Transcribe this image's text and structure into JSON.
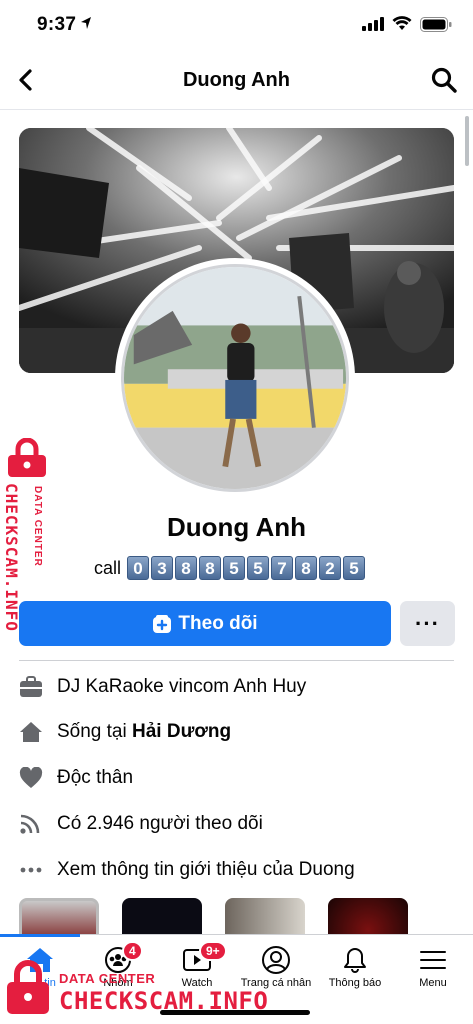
{
  "status_bar": {
    "time": "9:37"
  },
  "header": {
    "title": "Duong Anh"
  },
  "profile": {
    "name": "Duong Anh",
    "call_label": "call",
    "phone_digits": [
      "0",
      "3",
      "8",
      "8",
      "5",
      "5",
      "7",
      "8",
      "2",
      "5"
    ],
    "follow_label": "Theo dõi",
    "more_label": "···"
  },
  "info": {
    "work": "DJ KaRaoke vincom Anh Huy",
    "lives_prefix": "Sống tại ",
    "lives_place": "Hải Dương",
    "relationship": "Độc thân",
    "followers": "Có 2.946 người theo dõi",
    "see_more": "Xem thông tin giới thiệu của Duong"
  },
  "tabbar": {
    "tabs": [
      {
        "label": "tin",
        "icon": "home-icon"
      },
      {
        "label": "Nhóm",
        "icon": "groups-icon",
        "badge": "4"
      },
      {
        "label": "Watch",
        "icon": "watch-icon",
        "badge": "9+"
      },
      {
        "label": "Trang cá nhân",
        "icon": "profile-icon"
      },
      {
        "label": "Thông báo",
        "icon": "bell-icon"
      },
      {
        "label": "Menu",
        "icon": "menu-icon"
      }
    ]
  },
  "watermark": {
    "brand": "CHECKSCAM.INFO",
    "tagline": "DATA CENTER"
  },
  "colors": {
    "accent": "#1877f2",
    "badge": "#e41e3f",
    "watermark": "#e41e3f"
  }
}
